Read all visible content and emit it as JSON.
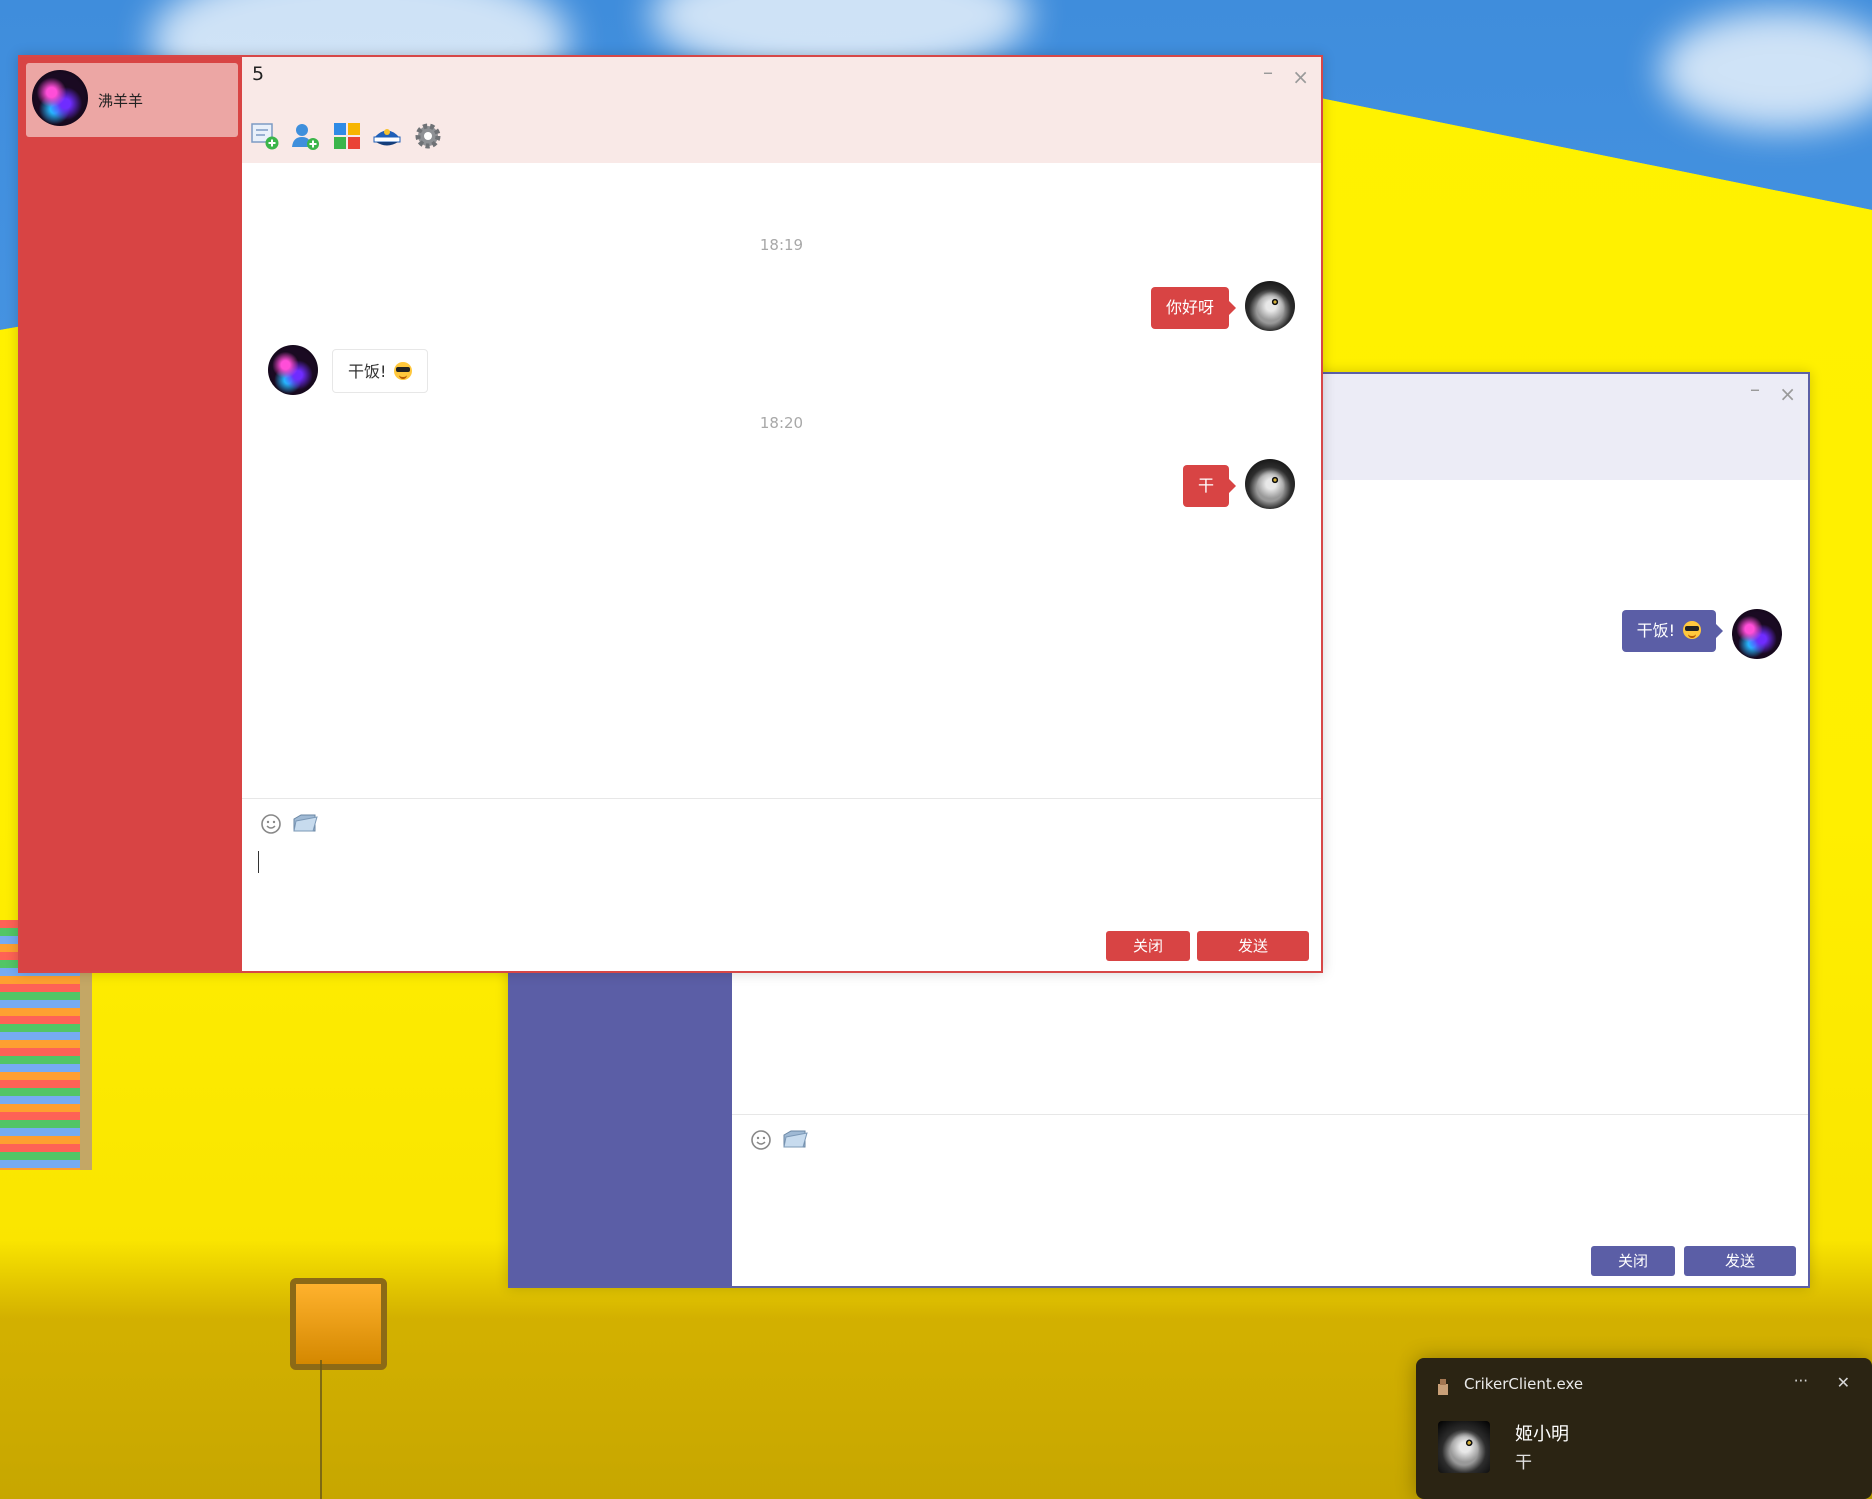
{
  "red_window": {
    "title": "5",
    "accent_color": "#d84444",
    "minimize_glyph": "–",
    "close_glyph": "×",
    "contact": {
      "name": "沸羊羊",
      "avatar_icon": "nebula-avatar-icon"
    },
    "toolbar_icons": [
      "add-chat-icon",
      "add-friend-icon",
      "app-grid-icon",
      "police-hat-icon",
      "settings-gear-icon"
    ],
    "messages": [
      {
        "type": "time",
        "text": "18:19"
      },
      {
        "type": "out",
        "text": "你好呀"
      },
      {
        "type": "in",
        "text": "干饭!"
      },
      {
        "type": "time",
        "text": "18:20"
      },
      {
        "type": "out",
        "text": "干"
      }
    ],
    "input_tools": [
      "emoji-icon",
      "attach-file-icon"
    ],
    "close_label": "关闭",
    "send_label": "发送"
  },
  "blue_window": {
    "accent_color": "#5b5ea6",
    "minimize_glyph": "–",
    "close_glyph": "×",
    "messages": [
      {
        "type": "out",
        "text": "干饭!"
      }
    ],
    "input_tools": [
      "emoji-icon",
      "attach-file-icon"
    ],
    "close_label": "关闭",
    "send_label": "发送"
  },
  "toast": {
    "app_name": "CrikerClient.exe",
    "more_glyph": "···",
    "close_glyph": "✕",
    "sender": "姬小明",
    "message": "干"
  }
}
